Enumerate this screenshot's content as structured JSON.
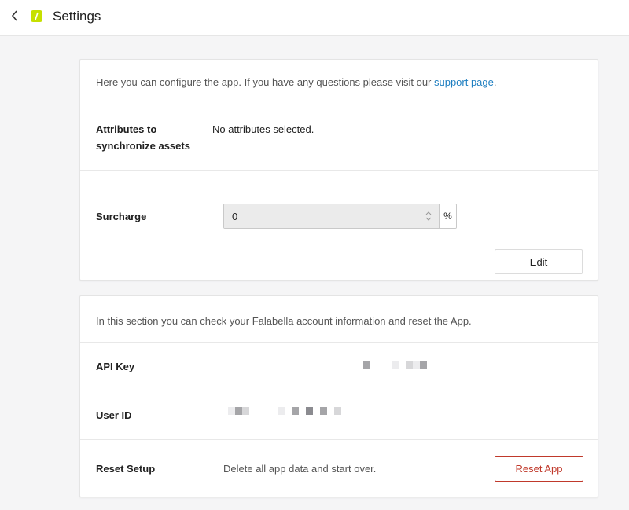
{
  "header": {
    "back_icon": "chevron-left-icon",
    "logo_icon": "falabella-logo-icon",
    "title": "Settings"
  },
  "config_card": {
    "intro_text": "Here you can configure the app. If you have any questions please visit our ",
    "intro_link": "support page",
    "intro_end": ".",
    "attributes": {
      "label_line1": "Attributes to",
      "label_line2": "synchronize assets",
      "value": "No attributes selected."
    },
    "surcharge": {
      "label": "Surcharge",
      "value": "0",
      "unit": "%"
    },
    "edit_button": "Edit"
  },
  "account_card": {
    "intro_text": "In this section you can check your Falabella account information and reset the App.",
    "api_key": {
      "label": "API Key"
    },
    "user_id": {
      "label": "User ID"
    },
    "reset": {
      "label": "Reset Setup",
      "description": "Delete all app data and start over.",
      "button": "Reset App"
    }
  },
  "colors": {
    "link": "#1f7fc1",
    "danger": "#c0392b",
    "logo": "#c6e000"
  }
}
